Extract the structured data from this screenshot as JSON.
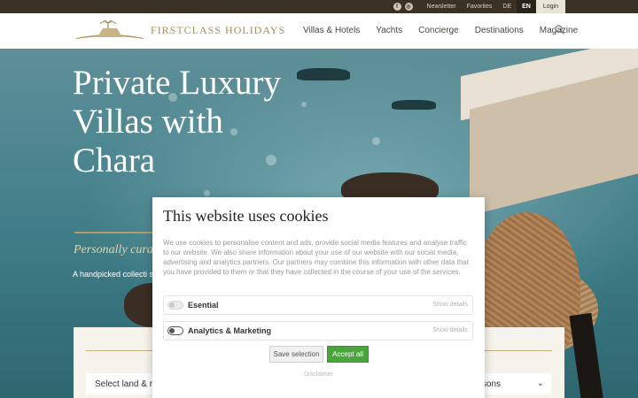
{
  "topbar": {
    "facebook_icon": "f",
    "instagram_icon": "◎",
    "newsletter": "Newsletter",
    "favorites": "Favorites",
    "lang_de": "DE",
    "lang_en": "EN",
    "login": "Login"
  },
  "header": {
    "brand": "FIRSTCLASS HOLIDAYS",
    "nav": [
      "Villas & Hotels",
      "Yachts",
      "Concierge",
      "Destinations",
      "Magazine"
    ],
    "search_icon": "search-icon"
  },
  "hero": {
    "title": "Private Luxury Villas with Chara",
    "tagline": "Personally cura",
    "intro": "A handpicked collecti service — for stays sh"
  },
  "search": {
    "land_field": "Select land & re",
    "persons_field": "ersons"
  },
  "cookie": {
    "title": "This website uses cookies",
    "text": "We use cookies to personalise content and ads, provide social media features and analyse traffic to our website. We also share information about your use of our website with our social media, advertising and analytics partners. Our partners may combine this information with other data that you have provided to them or that they have collected in the course of your use of the services.",
    "options": [
      {
        "label": "Esential",
        "details": "Show details"
      },
      {
        "label": "Analytics & Marketing",
        "details": "Show details"
      }
    ],
    "save_label": "Save selection",
    "accept_label": "Accept all",
    "disclaimer": "Disclaimer"
  },
  "colors": {
    "accent": "#b59b68",
    "accept": "#4ba53d",
    "topbar": "#3b3226"
  }
}
